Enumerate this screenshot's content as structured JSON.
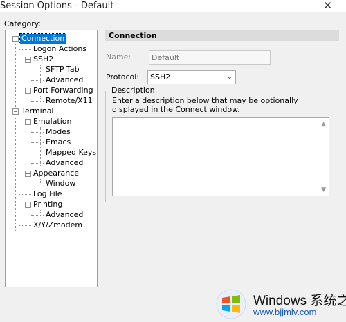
{
  "window": {
    "title": "Session Options - Default",
    "close_glyph": "✕"
  },
  "category_label": "Category:",
  "tree": {
    "items": [
      {
        "label": "Connection",
        "expander": "−"
      },
      {
        "label": "Logon Actions"
      },
      {
        "label": "SSH2",
        "expander": "−"
      },
      {
        "label": "SFTP Tab"
      },
      {
        "label": "Advanced"
      },
      {
        "label": "Port Forwarding",
        "expander": "−"
      },
      {
        "label": "Remote/X11"
      },
      {
        "label": "Terminal",
        "expander": "−"
      },
      {
        "label": "Emulation",
        "expander": "−"
      },
      {
        "label": "Modes"
      },
      {
        "label": "Emacs"
      },
      {
        "label": "Mapped Keys"
      },
      {
        "label": "Advanced"
      },
      {
        "label": "Appearance",
        "expander": "−"
      },
      {
        "label": "Window"
      },
      {
        "label": "Log File"
      },
      {
        "label": "Printing",
        "expander": "−"
      },
      {
        "label": "Advanced"
      },
      {
        "label": "X/Y/Zmodem"
      }
    ]
  },
  "panel": {
    "header": "Connection",
    "name_label": "Name:",
    "name_value": "Default",
    "protocol_label": "Protocol:",
    "protocol_value": "SSH2",
    "description_legend": "Description",
    "description_help": "Enter a description below that may be optionally displayed in the Connect window.",
    "description_value": "",
    "dropdown_glyph": "⌄",
    "scroll_up_glyph": "▲",
    "scroll_down_glyph": "▼"
  },
  "watermark": {
    "title": "Windows 系统之家",
    "subtitle": "www.bjjmlv.com",
    "logo_colors": [
      "#f35325",
      "#81bc06",
      "#05a6f0",
      "#ffba08"
    ]
  }
}
